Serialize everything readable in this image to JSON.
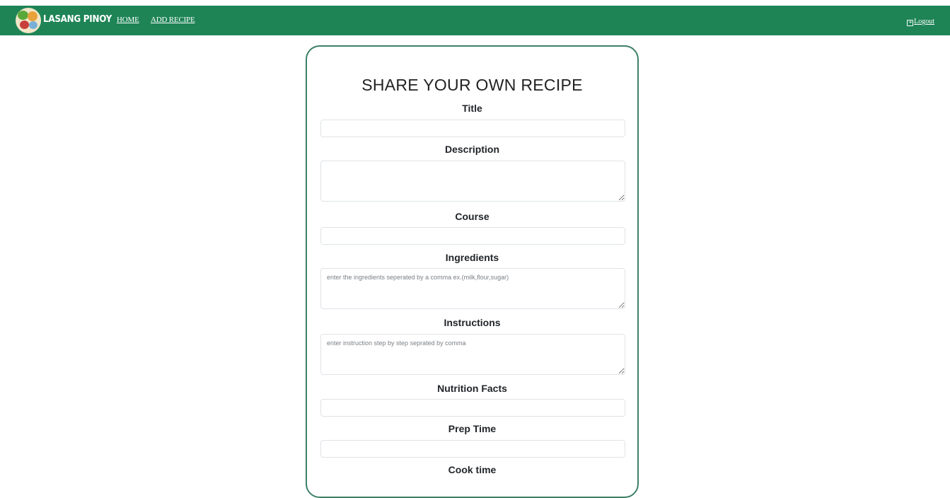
{
  "nav": {
    "brand": "LASANG PINOY",
    "links": [
      "HOME",
      "ADD RECIPE"
    ],
    "logout": "Logout"
  },
  "form": {
    "heading": "SHARE YOUR OWN RECIPE",
    "fields": [
      {
        "label": "Title",
        "value": "",
        "placeholder": ""
      },
      {
        "label": "Description",
        "value": "",
        "placeholder": ""
      },
      {
        "label": "Course",
        "value": "",
        "placeholder": ""
      },
      {
        "label": "Ingredients",
        "value": "",
        "placeholder": "enter the ingredients seperated by a comma ex.(milk,flour,sugar)"
      },
      {
        "label": "Instructions",
        "value": "",
        "placeholder": "enter instruction step by step seprated by comma"
      },
      {
        "label": "Nutrition Facts",
        "value": "",
        "placeholder": ""
      },
      {
        "label": "Prep Time",
        "value": "",
        "placeholder": ""
      },
      {
        "label": "Cook time",
        "value": "",
        "placeholder": ""
      }
    ]
  },
  "colors": {
    "navbar": "#1e8456",
    "card_border": "#3d8066"
  }
}
